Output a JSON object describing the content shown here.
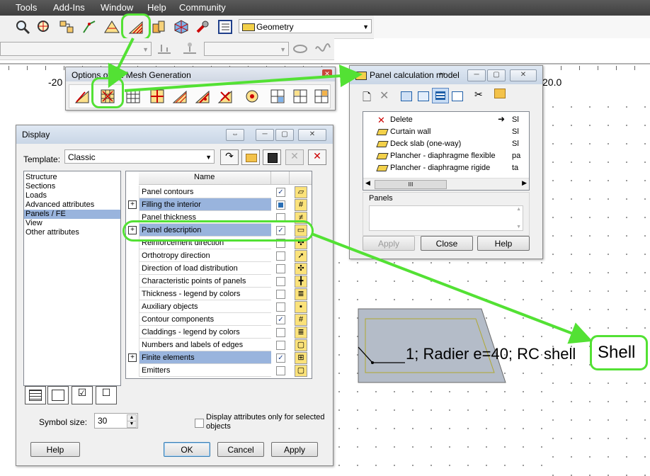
{
  "menubar": {
    "items": [
      "Tools",
      "Add-Ins",
      "Window",
      "Help",
      "Community"
    ]
  },
  "toolbar": {
    "geometry_select": "Geometry"
  },
  "ruler": {
    "left_label": "-20",
    "right_label": "20.0"
  },
  "fe_mesh": {
    "title": "Options of FE Mesh Generation"
  },
  "panel_calc": {
    "title": "Panel calculation model",
    "models": [
      {
        "name": "Delete",
        "right": "Sl"
      },
      {
        "name": "Curtain wall",
        "right": "Sl"
      },
      {
        "name": "Deck slab (one-way)",
        "right": "Sl"
      },
      {
        "name": "Plancher - diaphragme flexible",
        "right": "pa"
      },
      {
        "name": "Plancher - diaphragme rigide",
        "right": "ta"
      }
    ],
    "scroll_grip": "III",
    "panels_label": "Panels",
    "apply": "Apply",
    "close": "Close",
    "help": "Help"
  },
  "display": {
    "title": "Display",
    "template_label": "Template:",
    "template_value": "Classic",
    "categories": [
      "Structure",
      "Sections",
      "Loads",
      "Advanced attributes",
      "Panels / FE",
      "View",
      "Other attributes"
    ],
    "selected_category": "Panels / FE",
    "column_name": "Name",
    "rows": [
      {
        "name": "Panel contours",
        "checked": true,
        "expand": false
      },
      {
        "name": "Filling the interior",
        "checked": "partial",
        "expand": true
      },
      {
        "name": "Panel thickness",
        "checked": false,
        "expand": false
      },
      {
        "name": "Panel description",
        "checked": true,
        "expand": true
      },
      {
        "name": "Reinforcement direction",
        "checked": false,
        "expand": false
      },
      {
        "name": "Orthotropy direction",
        "checked": false,
        "expand": false
      },
      {
        "name": "Direction of load distribution",
        "checked": false,
        "expand": false
      },
      {
        "name": "Characteristic points of panels",
        "checked": false,
        "expand": false
      },
      {
        "name": "Thickness - legend by colors",
        "checked": false,
        "expand": false
      },
      {
        "name": "Auxiliary objects",
        "checked": false,
        "expand": false
      },
      {
        "name": "Contour components",
        "checked": true,
        "expand": false
      },
      {
        "name": "Claddings - legend by colors",
        "checked": false,
        "expand": false
      },
      {
        "name": "Numbers and labels of edges",
        "checked": false,
        "expand": false
      },
      {
        "name": "Finite elements",
        "checked": true,
        "expand": true
      },
      {
        "name": "Emitters",
        "checked": false,
        "expand": false
      }
    ],
    "symbol_size_label": "Symbol size:",
    "symbol_size_value": "30",
    "only_selected_label": "Display attributes only for selected objects",
    "help": "Help",
    "ok": "OK",
    "cancel": "Cancel",
    "apply": "Apply"
  },
  "canvas": {
    "panel_label": "1; Radier e=40; RC shell",
    "callout": "Shell"
  },
  "colors": {
    "highlight": "#53e134",
    "selection": "#99b4dd",
    "panel_fill": "#b4bcc8"
  }
}
